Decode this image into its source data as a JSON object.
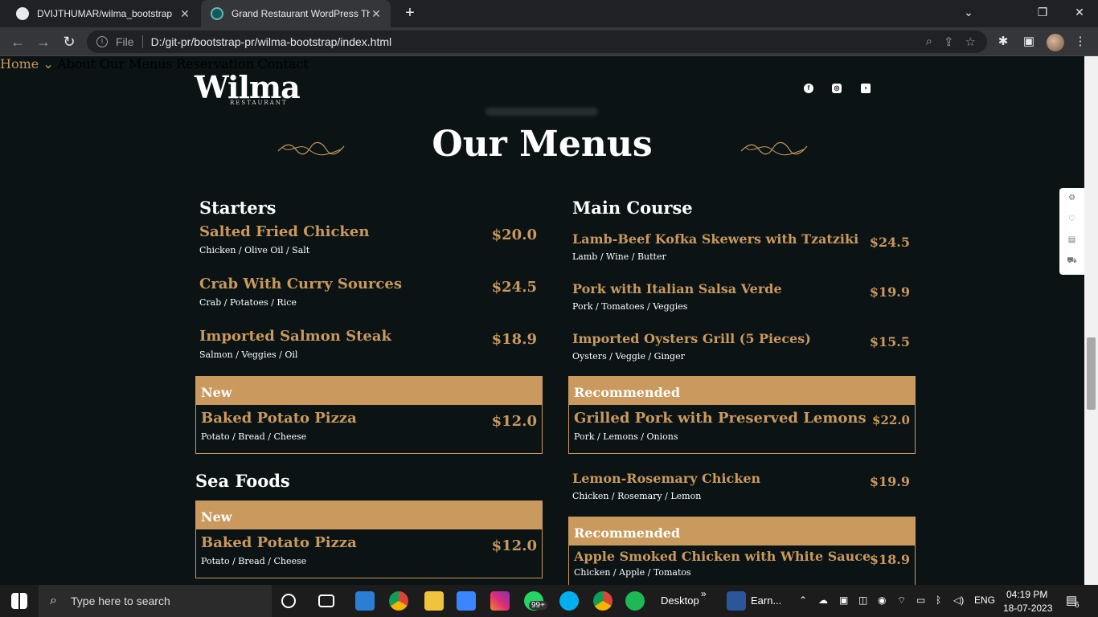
{
  "browser": {
    "tabs": [
      {
        "title": "DVIJTHUMAR/wilma_bootstrap",
        "active": false
      },
      {
        "title": "Grand Restaurant WordPress The",
        "active": true
      }
    ],
    "address": {
      "scheme_label": "File",
      "url": "D:/git-pr/bootstrap-pr/wilma-bootstrap/index.html"
    }
  },
  "site": {
    "logo": {
      "word": "Wilma",
      "sub": "RESTAURANT"
    },
    "nav": [
      {
        "label": "Home",
        "active": true
      },
      {
        "label": "About"
      },
      {
        "label": "Our Menus"
      },
      {
        "label": "Reservation"
      },
      {
        "label": "Contact"
      }
    ],
    "heading": "Our Menus",
    "colors": {
      "accent": "#c9995d",
      "background": "#0b1315",
      "text": "#ffffff"
    }
  },
  "menu": {
    "starters": {
      "title": "Starters",
      "items": [
        {
          "name": "Salted Fried Chicken",
          "desc": "Chicken / Olive Oil / Salt",
          "price": "$20.0"
        },
        {
          "name": "Crab With Curry Sources",
          "desc": "Crab / Potatoes / Rice",
          "price": "$24.5"
        },
        {
          "name": "Imported Salmon Steak",
          "desc": "Salmon / Veggies / Oil",
          "price": "$18.9"
        }
      ],
      "featured": {
        "tag": "New",
        "name": "Baked Potato Pizza",
        "desc": "Potato / Bread / Cheese",
        "price": "$12.0"
      }
    },
    "main_course": {
      "title": "Main Course",
      "items": [
        {
          "name": "Lamb-Beef Kofka Skewers with Tzatziki",
          "desc": "Lamb / Wine / Butter",
          "price": "$24.5"
        },
        {
          "name": "Pork with Italian Salsa Verde",
          "desc": "Pork / Tomatoes / Veggies",
          "price": "$19.9"
        },
        {
          "name": "Imported Oysters Grill (5 Pieces)",
          "desc": "Oysters / Veggie / Ginger",
          "price": "$15.5"
        }
      ],
      "featured": {
        "tag": "Recommended",
        "name": "Grilled Pork with Preserved Lemons",
        "desc": "Pork / Lemons / Onions",
        "price": "$22.0"
      },
      "extra": {
        "name": "Lemon-Rosemary Chicken",
        "desc": "Chicken / Rosemary / Lemon",
        "price": "$19.9"
      },
      "featured2": {
        "tag": "Recommended",
        "name": "Apple Smoked Chicken with White Sauce",
        "desc": "Chicken / Apple / Tomatos",
        "price": "$18.9"
      }
    },
    "sea_foods": {
      "title": "Sea Foods",
      "featured": {
        "tag": "New",
        "name": "Baked Potato Pizza",
        "desc": "Potato / Bread / Cheese",
        "price": "$12.0"
      }
    }
  },
  "taskbar": {
    "search_placeholder": "Type here to search",
    "desktop_label": "Desktop",
    "earn_label": "Earn...",
    "whatsapp_badge": "99+",
    "lang": "ENG",
    "time": "04:19 PM",
    "date": "18-07-2023",
    "notif_count": "6"
  }
}
